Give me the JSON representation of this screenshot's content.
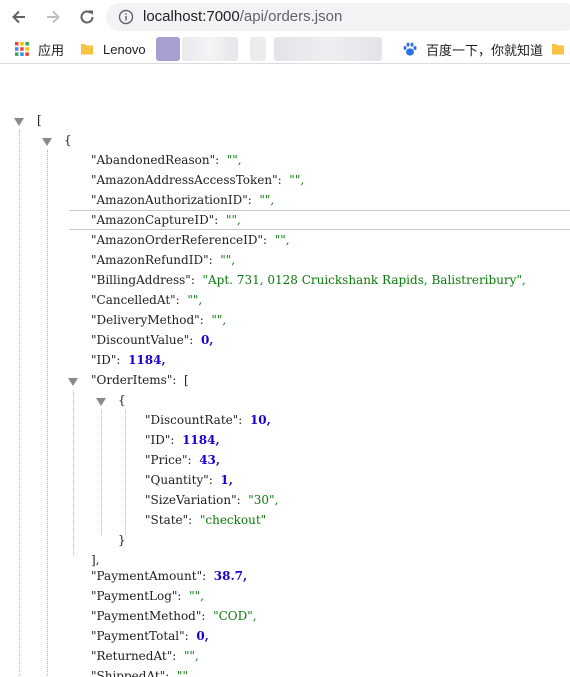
{
  "browser": {
    "url_host": "localhost:7000",
    "url_path": "/api/orders.json",
    "bookmarks": {
      "apps_label": "应用",
      "lenovo_label": "Lenovo",
      "baidu_label": "百度一下，你就知道"
    }
  },
  "json": {
    "open_bracket": "[",
    "open_brace": "{",
    "close_brace": "}",
    "close_array": "],",
    "rows": [
      {
        "key": "\"AbandonedReason\"",
        "value": "\"\",",
        "type": "s"
      },
      {
        "key": "\"AmazonAddressAccessToken\"",
        "value": "\"\",",
        "type": "s"
      },
      {
        "key": "\"AmazonAuthorizationID\"",
        "value": "\"\",",
        "type": "s"
      },
      {
        "key": "\"AmazonCaptureID\"",
        "value": "\"\",",
        "type": "s"
      },
      {
        "key": "\"AmazonOrderReferenceID\"",
        "value": "\"\",",
        "type": "s"
      },
      {
        "key": "\"AmazonRefundID\"",
        "value": "\"\",",
        "type": "s"
      },
      {
        "key": "\"BillingAddress\"",
        "value": "\"Apt. 731, 0128 Cruickshank Rapids, Balistreribury\",",
        "type": "s"
      },
      {
        "key": "\"CancelledAt\"",
        "value": "\"\",",
        "type": "s"
      },
      {
        "key": "\"DeliveryMethod\"",
        "value": "\"\",",
        "type": "s"
      },
      {
        "key": "\"DiscountValue\"",
        "value": "0,",
        "type": "n"
      },
      {
        "key": "\"ID\"",
        "value": "1184,",
        "type": "n"
      }
    ],
    "order_items_key": "\"OrderItems\"",
    "order_items_open": "[",
    "item_rows": [
      {
        "key": "\"DiscountRate\"",
        "value": "10,",
        "type": "n"
      },
      {
        "key": "\"ID\"",
        "value": "1184,",
        "type": "n"
      },
      {
        "key": "\"Price\"",
        "value": "43,",
        "type": "n"
      },
      {
        "key": "\"Quantity\"",
        "value": "1,",
        "type": "n"
      },
      {
        "key": "\"SizeVariation\"",
        "value": "\"30\",",
        "type": "s"
      },
      {
        "key": "\"State\"",
        "value": "\"checkout\"",
        "type": "s"
      }
    ],
    "after_rows": [
      {
        "key": "\"PaymentAmount\"",
        "value": "38.7,",
        "type": "n"
      },
      {
        "key": "\"PaymentLog\"",
        "value": "\"\",",
        "type": "s"
      },
      {
        "key": "\"PaymentMethod\"",
        "value": "\"COD\",",
        "type": "s"
      },
      {
        "key": "\"PaymentTotal\"",
        "value": "0,",
        "type": "n"
      },
      {
        "key": "\"ReturnedAt\"",
        "value": "\"\",",
        "type": "s"
      },
      {
        "key": "\"ShippedAt\"",
        "value": "\"\"",
        "type": "s"
      }
    ]
  },
  "colors": {
    "string": "#0b7a0b",
    "number": "#1c00cf",
    "omnibox": "#f1f3f4"
  }
}
